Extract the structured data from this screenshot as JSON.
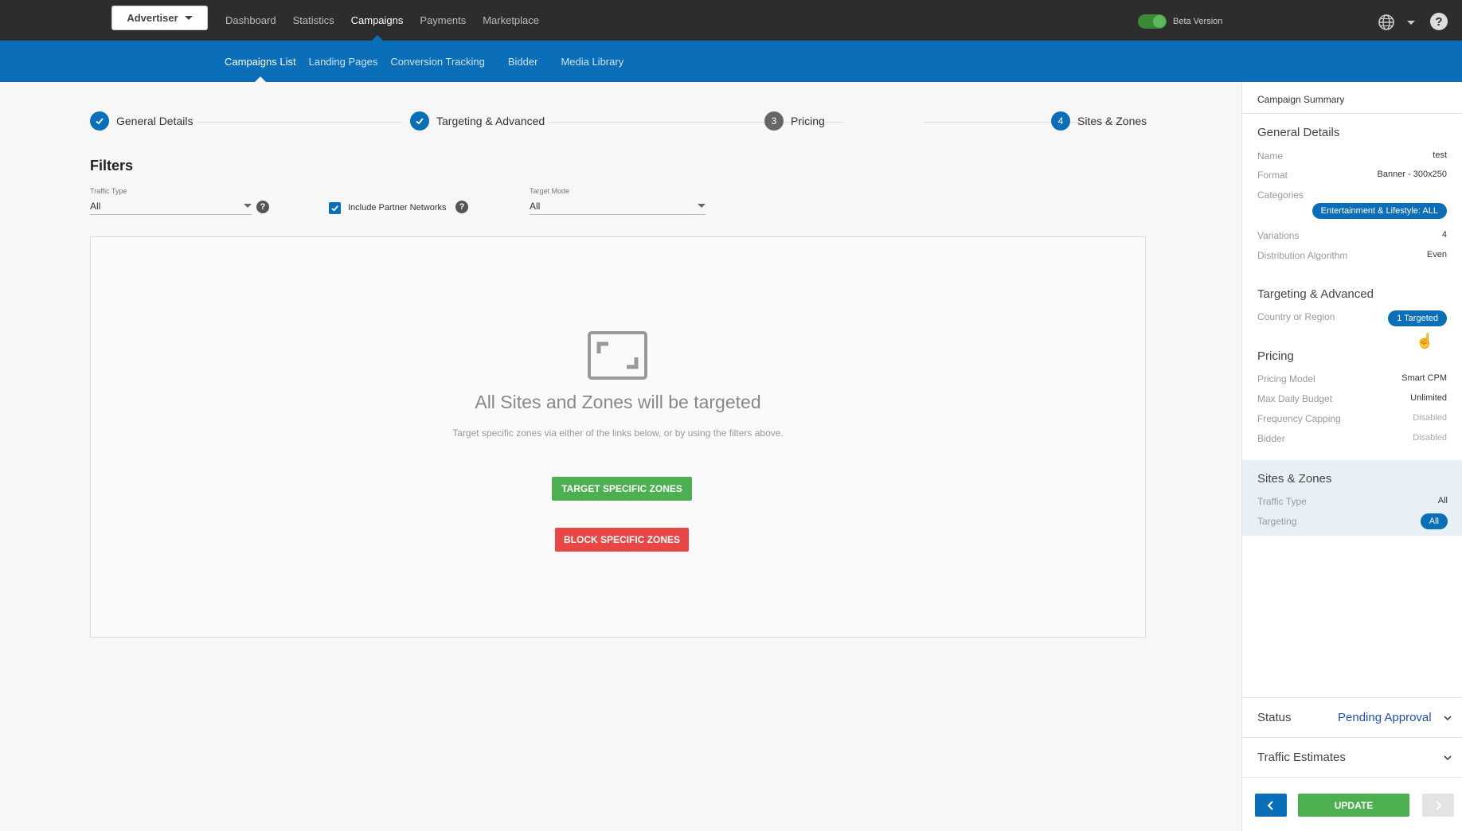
{
  "topbar": {
    "account_button": "Advertiser",
    "nav": [
      "Dashboard",
      "Statistics",
      "Campaigns",
      "Payments",
      "Marketplace"
    ],
    "beta_label": "Beta Version",
    "help_glyph": "?"
  },
  "subnav": [
    "Campaigns List",
    "Landing Pages",
    "Conversion Tracking",
    "Bidder",
    "Media Library"
  ],
  "stepper": {
    "steps": [
      {
        "label": "General Details",
        "state": "done"
      },
      {
        "label": "Targeting & Advanced",
        "state": "done"
      },
      {
        "label": "Pricing",
        "number": "3",
        "state": "pending"
      },
      {
        "label": "Sites & Zones",
        "number": "4",
        "state": "current"
      }
    ]
  },
  "filters": {
    "title": "Filters",
    "traffic_type": {
      "label": "Traffic Type",
      "value": "All"
    },
    "partner_networks": {
      "label": "Include Partner Networks",
      "checked": true
    },
    "target_mode": {
      "label": "Target Mode",
      "value": "All"
    },
    "help_glyph": "?"
  },
  "main": {
    "empty_title": "All Sites and Zones will be targeted",
    "empty_sub": "Target specific zones via either of the links below, or by using the filters above.",
    "target_button": "TARGET SPECIFIC ZONES",
    "block_button": "BLOCK SPECIFIC ZONES"
  },
  "summary": {
    "header": "Campaign Summary",
    "general": {
      "title": "General Details",
      "name_label": "Name",
      "name_value": "test",
      "format_label": "Format",
      "format_value": "Banner - 300x250",
      "categories_label": "Categories",
      "categories_value": "Entertainment & Lifestyle: ALL",
      "variations_label": "Variations",
      "variations_value": "4",
      "distribution_label": "Distribution Algorithm",
      "distribution_value": "Even"
    },
    "targeting": {
      "title": "Targeting & Advanced",
      "country_label": "Country or Region",
      "country_value": "1 Targeted"
    },
    "pricing": {
      "title": "Pricing",
      "model_label": "Pricing Model",
      "model_value": "Smart CPM",
      "budget_label": "Max Daily Budget",
      "budget_value": "Unlimited",
      "frequency_label": "Frequency Capping",
      "frequency_value": "Disabled",
      "bidder_label": "Bidder",
      "bidder_value": "Disabled"
    },
    "sites": {
      "title": "Sites & Zones",
      "traffic_label": "Traffic Type",
      "traffic_value": "All",
      "targeting_label": "Targeting",
      "targeting_value": "All"
    },
    "status_label": "Status",
    "status_value": "Pending Approval",
    "traffic_estimates": "Traffic Estimates",
    "update_button": "UPDATE"
  },
  "colors": {
    "topbar": "#2d2d2d",
    "subbar": "#0a6eb8",
    "green": "#4caf50",
    "red": "#e94646",
    "status_blue": "#1f4fb4"
  }
}
